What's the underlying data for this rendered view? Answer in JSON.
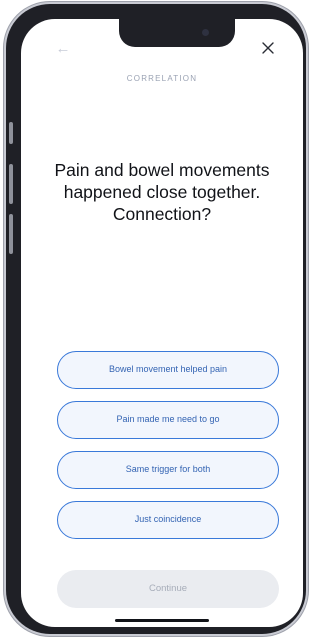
{
  "header": {
    "back_icon": "arrow-left-icon",
    "close_icon": "close-icon",
    "eyebrow": "CORRELATION"
  },
  "question": {
    "text": "Pain and bowel movements happened close together. Connection?"
  },
  "options": [
    {
      "label": "Bowel movement helped pain"
    },
    {
      "label": "Pain made me need to go"
    },
    {
      "label": "Same trigger for both"
    },
    {
      "label": "Just coincidence"
    }
  ],
  "footer": {
    "continue_label": "Continue"
  },
  "colors": {
    "accent": "#3a79d9",
    "accent_text": "#3464b3",
    "option_fill": "#f2f6fd",
    "disabled_bg": "#eaecf0",
    "disabled_text": "#a7adb9",
    "eyebrow": "#9aa2b3"
  }
}
